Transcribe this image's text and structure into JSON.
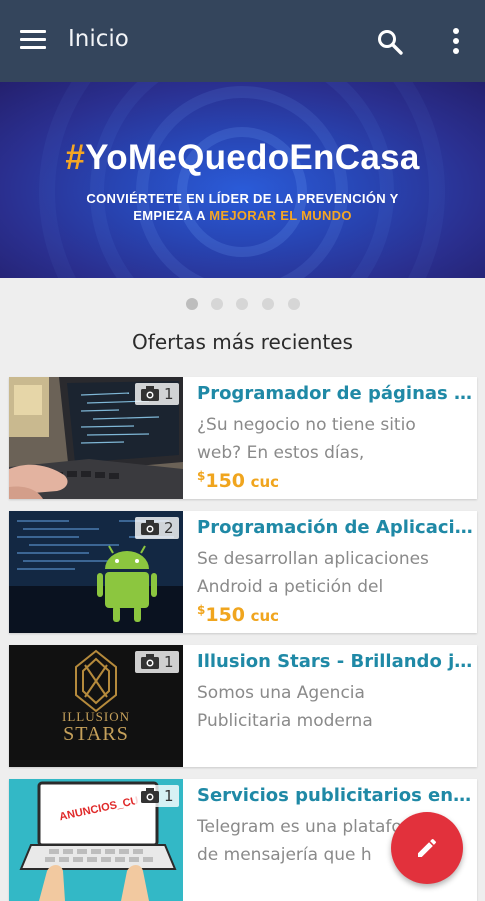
{
  "appbar": {
    "title": "Inicio",
    "menu_icon": "menu-icon",
    "search_icon": "search-icon",
    "more_icon": "more-vert-icon"
  },
  "banner": {
    "hash": "#",
    "headline": "YoMeQuedoEnCasa",
    "line1": "CONVIÉRTETE EN LÍDER DE LA PREVENCIÓN Y",
    "line2_prefix": "EMPIEZA A ",
    "line2_highlight": "MEJORAR EL MUNDO",
    "accent_color": "#f5a623"
  },
  "carousel": {
    "pages": 5,
    "active_index": 0
  },
  "section": {
    "title": "Ofertas más recientes"
  },
  "listings": [
    {
      "title": "Programador de páginas w...",
      "desc_line1": "¿Su negocio no tiene sitio",
      "desc_line2": "web? En estos días,",
      "price_currency": "$",
      "price_amount": "150",
      "price_unit": "cuc",
      "photo_count": "1",
      "thumb": "laptop-code"
    },
    {
      "title": "Programación de Aplicacio...",
      "desc_line1": "Se desarrollan aplicaciones",
      "desc_line2": "Android a petición del",
      "price_currency": "$",
      "price_amount": "150",
      "price_unit": "cuc",
      "photo_count": "2",
      "thumb": "android-robot"
    },
    {
      "title": "Illusion Stars - Brillando junt...",
      "desc_line1": "Somos una Agencia",
      "desc_line2": "Publicitaria moderna",
      "photo_count": "1",
      "thumb": "illusion-stars-logo",
      "logo_text_1": "ILLUSION",
      "logo_text_2": "STARS"
    },
    {
      "title": "Servicios publicitarios en Te...",
      "desc_line1": "Telegram es una plataforma",
      "desc_line2": "de mensajería que h",
      "photo_count": "1",
      "thumb": "anuncios-laptop",
      "screen_text": "ANUNCIOS_CU"
    }
  ],
  "fab": {
    "icon": "pencil-icon",
    "color": "#e2313c"
  },
  "colors": {
    "appbar": "#34455c",
    "title_link": "#1f89a6",
    "price": "#f0a51e",
    "muted_text": "#8a8a8a"
  }
}
